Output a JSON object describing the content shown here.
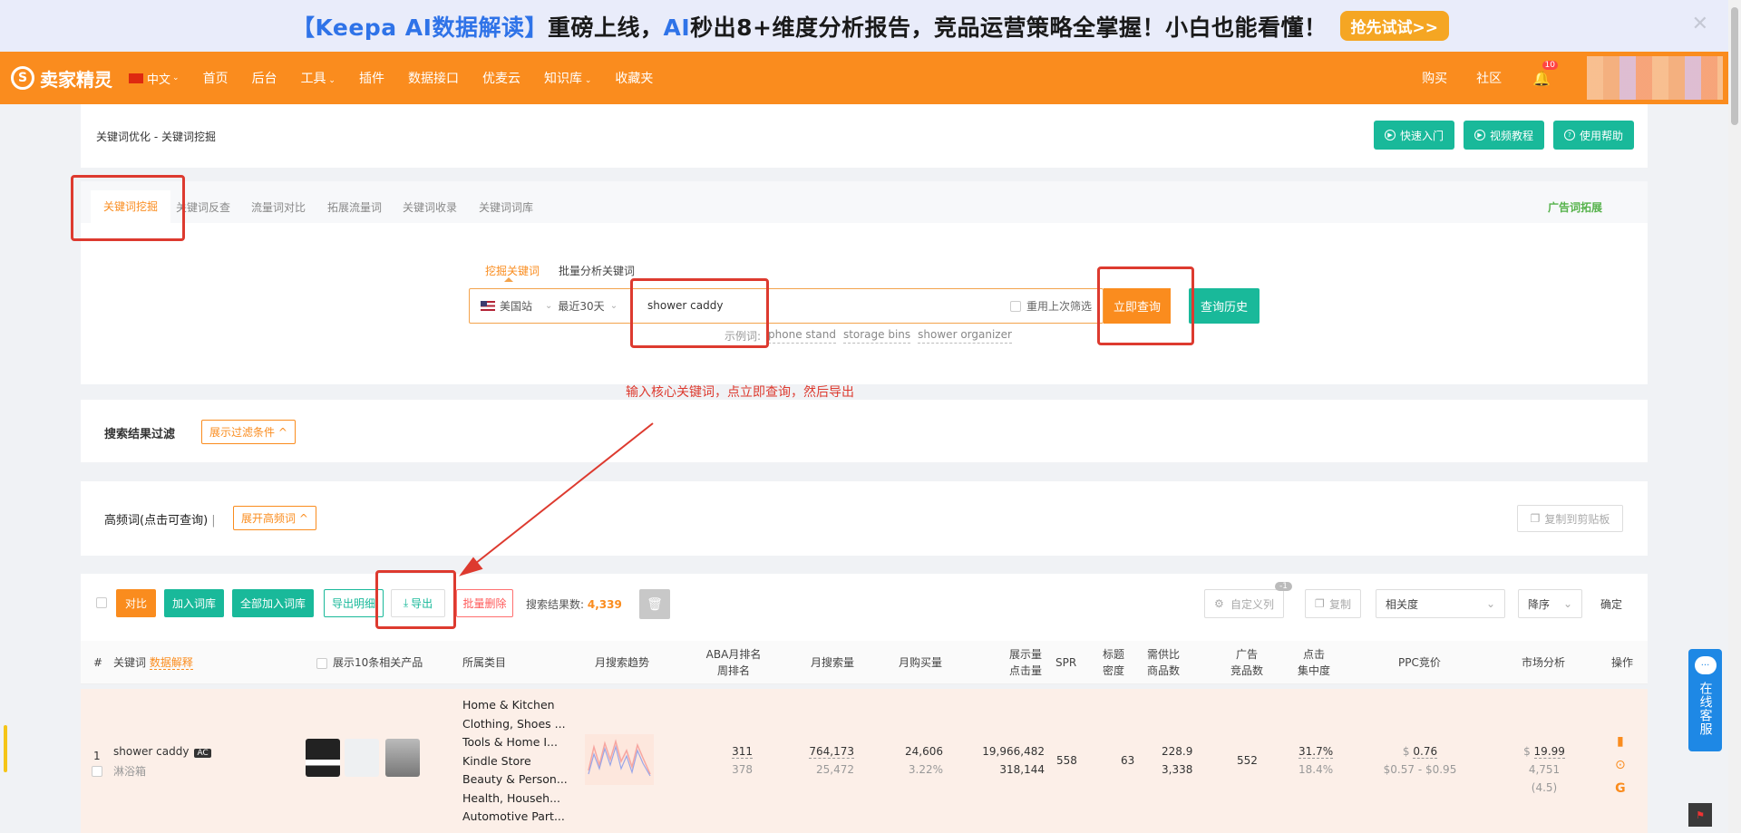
{
  "banner": {
    "bracket_open": "【",
    "brand": "Keepa AI",
    "title_part1": "数据解读",
    "bracket_close": "】",
    "title_part2": "重磅上线，",
    "ai": "AI",
    "title_part3": "秒出8+维度分析报告，竞品运营策略全掌握！小白也能看懂！",
    "cta": "抢先试试>>",
    "close": "✕"
  },
  "nav": {
    "logo_mark": "S",
    "logo_text": "卖家精灵",
    "lang": "中文",
    "items": [
      "首页",
      "后台",
      "工具",
      "插件",
      "数据接口",
      "优麦云",
      "知识库",
      "收藏夹"
    ],
    "right": [
      "购买",
      "社区"
    ],
    "bell_count": "10"
  },
  "header": {
    "breadcrumb": "关键词优化 - 关键词挖掘",
    "buttons": [
      "快速入门",
      "视频教程",
      "使用帮助"
    ]
  },
  "tabs": {
    "items": [
      "关键词挖掘",
      "关键词反查",
      "流量词对比",
      "拓展流量词",
      "关键词收录",
      "关键词词库"
    ],
    "right": "广告词拓展"
  },
  "search": {
    "subtabs": [
      "挖掘关键词",
      "批量分析关键词"
    ],
    "site": "美国站",
    "range": "最近30天",
    "keyword": "shower caddy",
    "reuse": "重用上次筛选",
    "query_btn": "立即查询",
    "history_btn": "查询历史",
    "example_label": "示例词:",
    "examples": [
      "phone stand",
      "storage bins",
      "shower organizer"
    ]
  },
  "annotation": "输入核心关键词，点立即查询，然后导出",
  "filter": {
    "label": "搜索结果过滤",
    "btn": "展示过滤条件 ^"
  },
  "freq": {
    "label": "高频词(点击可查询)",
    "btn": "展开高频词 ^",
    "copy": "复制到剪贴板"
  },
  "actions": {
    "compare": "对比",
    "add_lib": "加入词库",
    "add_all": "全部加入词库",
    "export_detail": "导出明细",
    "export": "导出",
    "batch_delete": "批量删除",
    "count_label": "搜索结果数:",
    "count": "4,339",
    "custom_col": "自定义列",
    "custom_badge": "-1",
    "copy": "复制",
    "sort_field": "相关度",
    "sort_order": "降序",
    "confirm": "确定"
  },
  "table": {
    "headers": {
      "num": "#",
      "kw": "关键词",
      "kw_link": "数据解释",
      "show10": "展示10条相关产品",
      "category": "所属类目",
      "trend": "月搜索趋势",
      "aba1": "ABA月排名",
      "aba2": "周排名",
      "msv": "月搜索量",
      "mpv": "月购买量",
      "imp1": "展示量",
      "imp2": "点击量",
      "spr": "SPR",
      "td1": "标题",
      "td2": "密度",
      "sd1": "需供比",
      "sd2": "商品数",
      "ad1": "广告",
      "ad2": "竞品数",
      "cc1": "点击",
      "cc2": "集中度",
      "ppc": "PPC竞价",
      "market": "市场分析",
      "ops": "操作"
    },
    "row": {
      "num": "1",
      "kw": "shower caddy",
      "ac": "AC",
      "kw_cn": "淋浴箱",
      "categories": [
        "Home & Kitchen",
        "Clothing, Shoes ...",
        "Tools & Home I...",
        "Kindle Store",
        "Beauty & Person...",
        "Health, Househ...",
        "Automotive Part..."
      ],
      "aba_month": "311",
      "aba_week": "378",
      "msv": "764,173",
      "msv_sub": "25,472",
      "mpv": "24,606",
      "mpv_sub": "3.22%",
      "imp": "19,966,482",
      "clk": "318,144",
      "spr": "558",
      "title_density": "63",
      "sd_ratio": "228.9",
      "sd_count": "3,338",
      "ad_count": "552",
      "cc": "31.7%",
      "cc_sub": "18.4%",
      "ppc_sym": "$",
      "ppc": "0.76",
      "ppc_range": "$0.57 - $0.95",
      "market_sym": "$",
      "market": "19.99",
      "market_sub": "4,751 (4.5)"
    }
  },
  "service": {
    "text": "在线客服"
  },
  "colors": {
    "brand_orange": "#fa8c1e",
    "teal": "#19b99a",
    "annotation_red": "#dd3a2f"
  }
}
